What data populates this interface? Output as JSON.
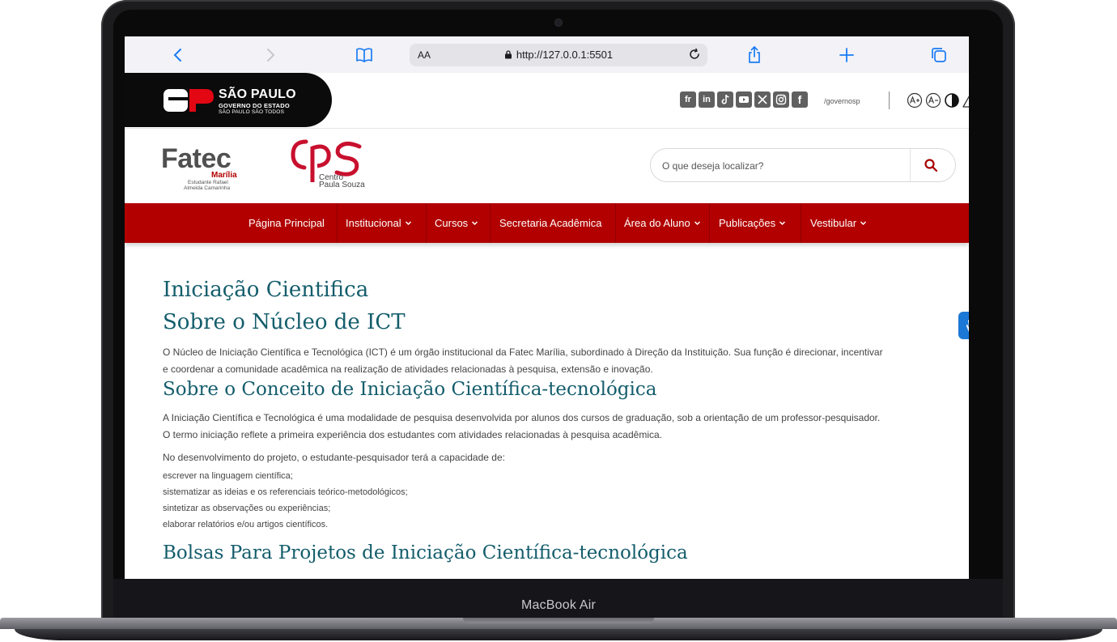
{
  "device": {
    "model_label": "MacBook Air"
  },
  "browser": {
    "text_size_label": "AA",
    "url": "http://127.0.0.1:5501"
  },
  "gov_header": {
    "logo_title": "SÃO PAULO",
    "logo_subtitle": "GOVERNO DO ESTADO",
    "logo_tagline": "SÃO PAULO SÃO TODOS",
    "logo_mark_text": "SP",
    "social_handle": "/governosp",
    "social_icons": [
      "flickr-icon",
      "linkedin-icon",
      "tiktok-icon",
      "youtube-icon",
      "x-icon",
      "instagram-icon",
      "facebook-icon"
    ],
    "accessibility_icons": [
      "increase-font-icon",
      "decrease-font-icon",
      "contrast-icon",
      "alert-icon"
    ]
  },
  "site_header": {
    "fatec_name": "Fatec",
    "fatec_city": "Marília",
    "fatec_patron_line1": "Estudante Rafael",
    "fatec_patron_line2": "Almeida Camarinha",
    "cps_name_line1": "Centro",
    "cps_name_line2": "Paula Souza",
    "search_placeholder": "O que deseja localizar?"
  },
  "nav": {
    "items": [
      {
        "label": "Página Principal",
        "dropdown": false
      },
      {
        "label": "Institucional",
        "dropdown": true
      },
      {
        "label": "Cursos",
        "dropdown": true
      },
      {
        "label": "Secretaria Acadêmica",
        "dropdown": false
      },
      {
        "label": "Área do Aluno",
        "dropdown": true
      },
      {
        "label": "Publicações",
        "dropdown": true
      },
      {
        "label": "Vestibular",
        "dropdown": true
      }
    ]
  },
  "content": {
    "page_title": "Iniciação Cientifica",
    "section1_title": "Sobre o Núcleo de ICT",
    "section1_p_line1": "O Núcleo de Iniciação Científica e Tecnológica (ICT) é um órgão institucional da Fatec Marília, subordinado à Direção da Instituição. Sua função é direcionar, incentivar",
    "section1_p_line2": "e coordenar a comunidade acadêmica na realização de atividades relacionadas à pesquisa, extensão e inovação.",
    "section2_title": "Sobre o Conceito de Iniciação Científica-tecnológica",
    "section2_p_line1": "A Iniciação Científica e Tecnológica é uma modalidade de pesquisa desenvolvida por alunos dos cursos de graduação, sob a orientação de um professor-pesquisador.",
    "section2_p_line2": "O termo iniciação reflete a primeira experiência dos estudantes com atividades relacionadas à pesquisa acadêmica.",
    "section2_intro": "No desenvolvimento do projeto, o estudante-pesquisador terá a capacidade de:",
    "capabilities": [
      "escrever na linguagem científica;",
      "sistematizar as ideias e os referenciais teórico-metodológicos;",
      "sintetizar as observações ou experiências;",
      "elaborar relatórios e/ou artigos científicos."
    ],
    "section3_title": "Bolsas Para Projetos de Iniciação Científica-tecnológica"
  },
  "colors": {
    "nav_red": "#b20000",
    "heading_teal": "#145d6c",
    "safari_blue": "#1a7cf5",
    "vlibras_blue": "#1c78d6"
  }
}
